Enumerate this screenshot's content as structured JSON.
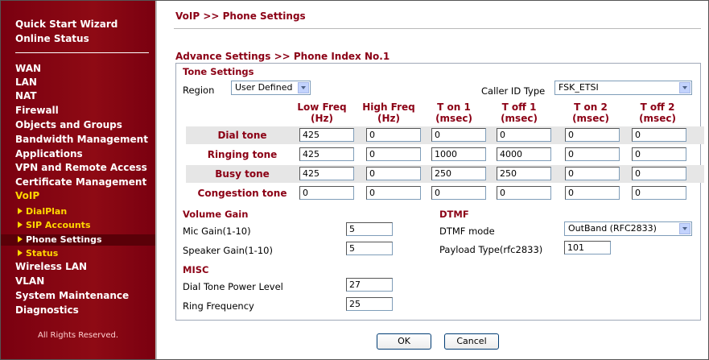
{
  "sidebar": {
    "top_items": [
      "Quick Start Wizard",
      "Online Status"
    ],
    "items": [
      "WAN",
      "LAN",
      "NAT",
      "Firewall",
      "Objects and Groups",
      "Bandwidth Management",
      "Applications",
      "VPN and Remote Access",
      "Certificate Management",
      "VoIP"
    ],
    "voip_subitems": [
      "DialPlan",
      "SIP Accounts",
      "Phone Settings",
      "Status"
    ],
    "bottom_items": [
      "Wireless LAN",
      "VLAN",
      "System Maintenance",
      "Diagnostics"
    ],
    "copyright": "All Rights Reserved."
  },
  "page": {
    "breadcrumb": "VoIP >> Phone Settings",
    "subtitle": "Advance Settings >> Phone Index No.1"
  },
  "tone": {
    "section": "Tone Settings",
    "region_label": "Region",
    "region_value": "User Defined",
    "caller_id_label": "Caller ID Type",
    "caller_id_value": "FSK_ETSI",
    "columns": [
      {
        "l1": "Low Freq",
        "l2": "(Hz)"
      },
      {
        "l1": "High Freq",
        "l2": "(Hz)"
      },
      {
        "l1": "T on 1",
        "l2": "(msec)"
      },
      {
        "l1": "T off 1",
        "l2": "(msec)"
      },
      {
        "l1": "T on 2",
        "l2": "(msec)"
      },
      {
        "l1": "T off 2",
        "l2": "(msec)"
      }
    ],
    "rows": [
      {
        "label": "Dial tone",
        "values": [
          "425",
          "0",
          "0",
          "0",
          "0",
          "0"
        ]
      },
      {
        "label": "Ringing tone",
        "values": [
          "425",
          "0",
          "1000",
          "4000",
          "0",
          "0"
        ]
      },
      {
        "label": "Busy tone",
        "values": [
          "425",
          "0",
          "250",
          "250",
          "0",
          "0"
        ]
      },
      {
        "label": "Congestion tone",
        "values": [
          "0",
          "0",
          "0",
          "0",
          "0",
          "0"
        ]
      }
    ]
  },
  "volume": {
    "section": "Volume Gain",
    "mic_label": "Mic Gain(1-10)",
    "mic_value": "5",
    "speaker_label": "Speaker Gain(1-10)",
    "speaker_value": "5"
  },
  "dtmf": {
    "section": "DTMF",
    "mode_label": "DTMF mode",
    "mode_value": "OutBand (RFC2833)",
    "payload_label": "Payload Type(rfc2833)",
    "payload_value": "101"
  },
  "misc": {
    "section": "MISC",
    "dial_power_label": "Dial Tone Power Level",
    "dial_power_value": "27",
    "ring_freq_label": "Ring Frequency",
    "ring_freq_value": "25"
  },
  "buttons": {
    "ok": "OK",
    "cancel": "Cancel"
  }
}
